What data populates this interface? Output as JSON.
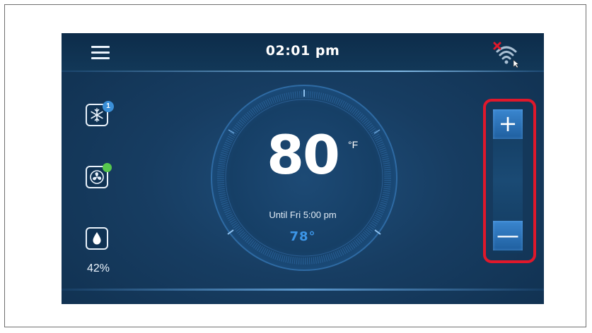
{
  "header": {
    "time": "02:01 pm",
    "menu_icon": "hamburger-menu-icon",
    "wifi_icon": "wifi-disconnected-icon"
  },
  "side_controls": {
    "mode": {
      "icon": "snowflake-cool-icon",
      "badge": "1"
    },
    "fan": {
      "icon": "fan-icon",
      "status": "on"
    },
    "humidity": {
      "icon": "water-drop-icon",
      "value": "42%"
    }
  },
  "thermostat": {
    "current_temp": "80",
    "unit": "°F",
    "schedule": "Until Fri 5:00 pm",
    "setpoint": "78°"
  },
  "adjust": {
    "increase_label": "+",
    "decrease_label": "—"
  },
  "colors": {
    "background": "#173d62",
    "accent": "#3c96e8",
    "highlight": "#e0182b",
    "fan_status": "#57c84d"
  }
}
